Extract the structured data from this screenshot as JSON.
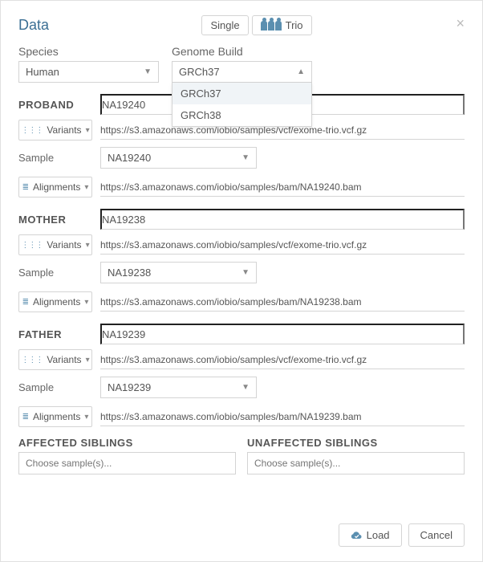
{
  "title": "Data",
  "mode": {
    "single": "Single",
    "trio": "Trio"
  },
  "species": {
    "label": "Species",
    "value": "Human"
  },
  "genome": {
    "label": "Genome Build",
    "value": "GRCh37",
    "options": [
      "GRCh37",
      "GRCh38"
    ]
  },
  "proband": {
    "label": "PROBAND",
    "id": "NA19240",
    "variants_btn": "Variants",
    "variants_url": "https://s3.amazonaws.com/iobio/samples/vcf/exome-trio.vcf.gz",
    "sample_label": "Sample",
    "sample_value": "NA19240",
    "align_btn": "Alignments",
    "align_url": "https://s3.amazonaws.com/iobio/samples/bam/NA19240.bam"
  },
  "mother": {
    "label": "MOTHER",
    "id": "NA19238",
    "variants_btn": "Variants",
    "variants_url": "https://s3.amazonaws.com/iobio/samples/vcf/exome-trio.vcf.gz",
    "sample_label": "Sample",
    "sample_value": "NA19238",
    "align_btn": "Alignments",
    "align_url": "https://s3.amazonaws.com/iobio/samples/bam/NA19238.bam"
  },
  "father": {
    "label": "FATHER",
    "id": "NA19239",
    "variants_btn": "Variants",
    "variants_url": "https://s3.amazonaws.com/iobio/samples/vcf/exome-trio.vcf.gz",
    "sample_label": "Sample",
    "sample_value": "NA19239",
    "align_btn": "Alignments",
    "align_url": "https://s3.amazonaws.com/iobio/samples/bam/NA19239.bam"
  },
  "siblings": {
    "affected_label": "AFFECTED SIBLINGS",
    "unaffected_label": "UNAFFECTED SIBLINGS",
    "placeholder": "Choose sample(s)..."
  },
  "footer": {
    "load": "Load",
    "cancel": "Cancel"
  }
}
